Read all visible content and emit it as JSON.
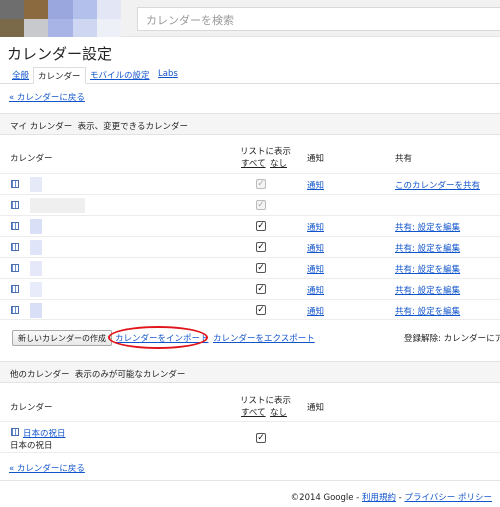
{
  "search": {
    "placeholder": "カレンダーを検索"
  },
  "page_title": "カレンダー設定",
  "tabs": [
    {
      "label": "全般"
    },
    {
      "label": "カレンダー"
    },
    {
      "label": "モバイルの設定"
    },
    {
      "label": "Labs"
    }
  ],
  "back_link": "« カレンダーに戻る",
  "my_calendars": {
    "title": "マイ カレンダー",
    "subtitle": "表示、変更できるカレンダー",
    "col_calendar": "カレンダー",
    "col_show_in_list": "リストに表示",
    "select_all": "すべて",
    "select_none": "なし",
    "col_notify": "通知",
    "col_share": "共有",
    "rows": [
      {
        "notify": "通知",
        "share": "このカレンダーを共有",
        "checked": true,
        "disabled": true
      },
      {
        "notify": "",
        "share": "",
        "checked": true,
        "disabled": true
      },
      {
        "notify": "通知",
        "share": "共有: 設定を編集",
        "checked": true,
        "disabled": false
      },
      {
        "notify": "通知",
        "share": "共有: 設定を編集",
        "checked": true,
        "disabled": false
      },
      {
        "notify": "通知",
        "share": "共有: 設定を編集",
        "checked": true,
        "disabled": false
      },
      {
        "notify": "通知",
        "share": "共有: 設定を編集",
        "checked": true,
        "disabled": false
      },
      {
        "notify": "通知",
        "share": "共有: 設定を編集",
        "checked": true,
        "disabled": false
      }
    ],
    "create_button": "新しいカレンダーの作成",
    "import_link": "カレンダーをインポート",
    "export_link": "カレンダーをエクスポート",
    "unsubscribe_text": "登録解除: カレンダーにア"
  },
  "other_calendars": {
    "title": "他のカレンダー",
    "subtitle": "表示のみが可能なカレンダー",
    "col_calendar": "カレンダー",
    "col_show_in_list": "リストに表示",
    "select_all": "すべて",
    "select_none": "なし",
    "col_notify": "通知",
    "rows": [
      {
        "name": "日本の祝日",
        "description": "日本の祝日",
        "checked": true
      }
    ]
  },
  "footer": {
    "copyright": "©2014 Google",
    "sep1": " - ",
    "terms": "利用規約",
    "sep2": " - ",
    "privacy": "プライバシー ポリシー"
  },
  "colors": {
    "link": "#1155cc",
    "highlight_ring": "#e0141a",
    "section_bg": "#f5f5f5",
    "topbar_bg": "#f1f1f1"
  }
}
